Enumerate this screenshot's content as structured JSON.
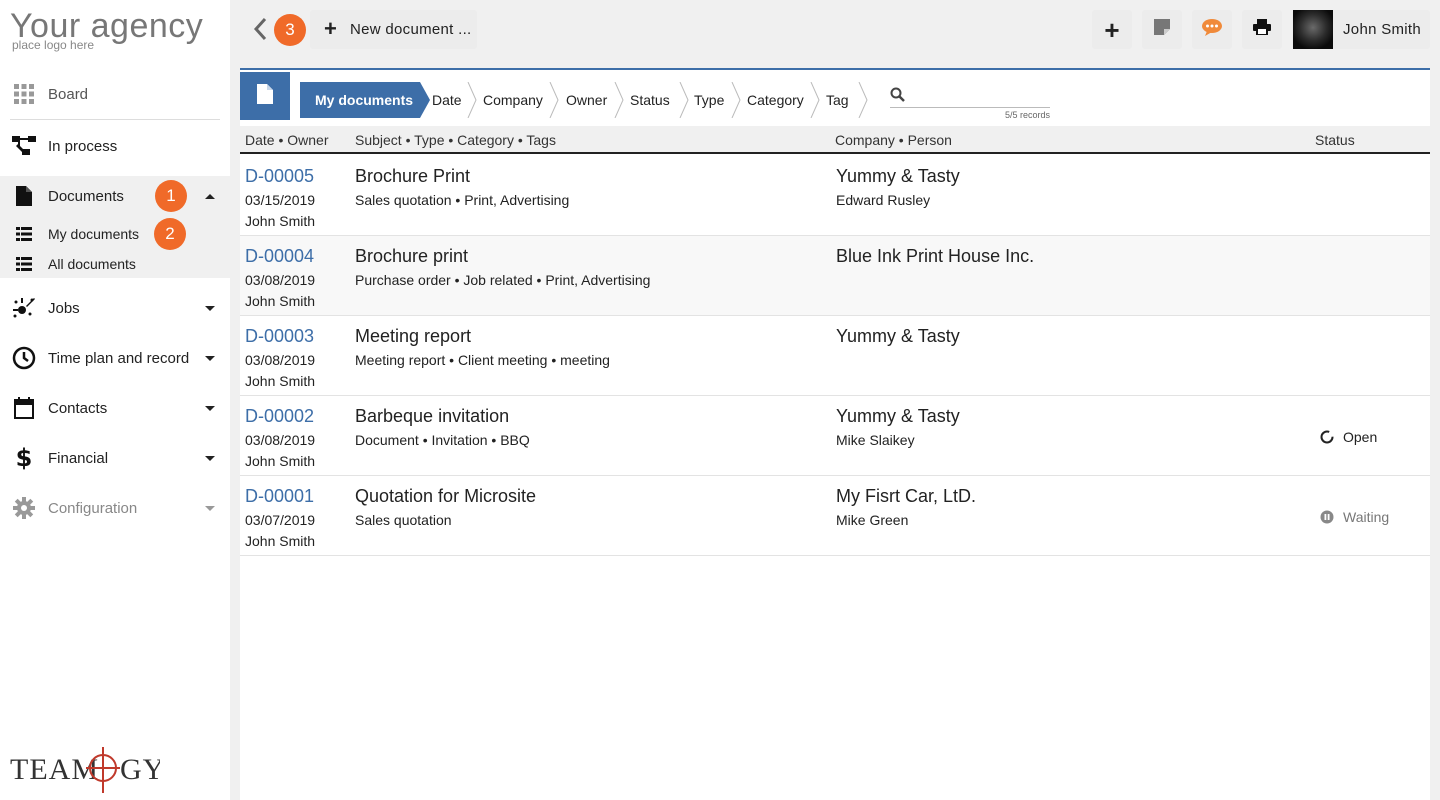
{
  "logo": {
    "title": "Your agency",
    "subtitle": "place logo here"
  },
  "sidebar": {
    "board": "Board",
    "in_process": "In process",
    "documents": "Documents",
    "my_documents": "My documents",
    "all_documents": "All documents",
    "jobs": "Jobs",
    "time_plan": "Time plan and record",
    "contacts": "Contacts",
    "financial": "Financial",
    "configuration": "Configuration",
    "badge_documents": "1",
    "badge_my_documents": "2"
  },
  "brand": {
    "name": "TEAMLOGY"
  },
  "topbar": {
    "badge_back": "3",
    "new_document": "New document ...",
    "user_name": "John Smith"
  },
  "colors": {
    "accent": "#3d6ea8",
    "badge": "#f06a29",
    "chat_icon": "#f08a3a"
  },
  "filters": {
    "active": "My documents",
    "items": [
      "Date",
      "Company",
      "Owner",
      "Status",
      "Type",
      "Category",
      "Tag"
    ],
    "search_placeholder": "",
    "records": "5/5 records"
  },
  "table": {
    "headers": [
      "Date • Owner",
      "Subject • Type • Category • Tags",
      "Company • Person",
      "Status"
    ],
    "rows": [
      {
        "id": "D-00005",
        "date": "03/15/2019",
        "owner": "John Smith",
        "subject": "Brochure Print",
        "meta": "Sales quotation • Print, Advertising",
        "company": "Yummy & Tasty",
        "person": "Edward Rusley",
        "status": ""
      },
      {
        "id": "D-00004",
        "date": "03/08/2019",
        "owner": "John Smith",
        "subject": "Brochure print",
        "meta": "Purchase order • Job related • Print, Advertising",
        "company": "Blue Ink Print House Inc.",
        "person": "",
        "status": ""
      },
      {
        "id": "D-00003",
        "date": "03/08/2019",
        "owner": "John Smith",
        "subject": "Meeting report",
        "meta": "Meeting report • Client meeting • meeting",
        "company": "Yummy & Tasty",
        "person": "",
        "status": ""
      },
      {
        "id": "D-00002",
        "date": "03/08/2019",
        "owner": "John Smith",
        "subject": "Barbeque invitation",
        "meta": "Document • Invitation • BBQ",
        "company": "Yummy & Tasty",
        "person": "Mike Slaikey",
        "status": "Open"
      },
      {
        "id": "D-00001",
        "date": "03/07/2019",
        "owner": "John Smith",
        "subject": "Quotation for Microsite",
        "meta": "Sales quotation",
        "company": "My Fisrt Car, LtD.",
        "person": "Mike Green",
        "status": "Waiting"
      }
    ]
  }
}
